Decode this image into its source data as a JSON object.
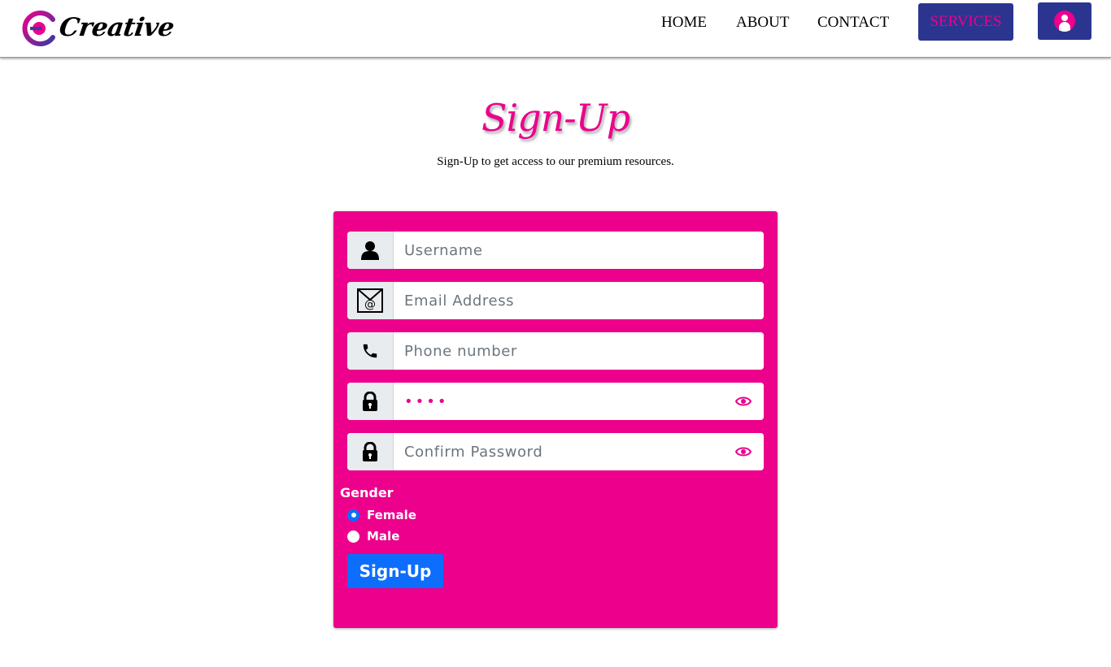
{
  "header": {
    "brand": "Creative",
    "nav": {
      "home": "HOME",
      "about": "ABOUT",
      "contact": "CONTACT",
      "services": "SERVICES"
    },
    "user_icon": "user-avatar-icon"
  },
  "page": {
    "title": "Sign-Up",
    "subtitle": "Sign-Up to get access to our premium resources."
  },
  "form": {
    "username_placeholder": "Username",
    "email_placeholder": "Email Address",
    "phone_placeholder": "Phone number",
    "password_value": "••••",
    "confirm_placeholder": "Confirm Password",
    "gender_label": "Gender",
    "gender_options": [
      "Female",
      "Male"
    ],
    "gender_selected": "Female",
    "submit_label": "Sign-Up"
  },
  "colors": {
    "accent": "#ec008c",
    "nav_button": "#2b3590",
    "submit": "#0d6efd"
  }
}
